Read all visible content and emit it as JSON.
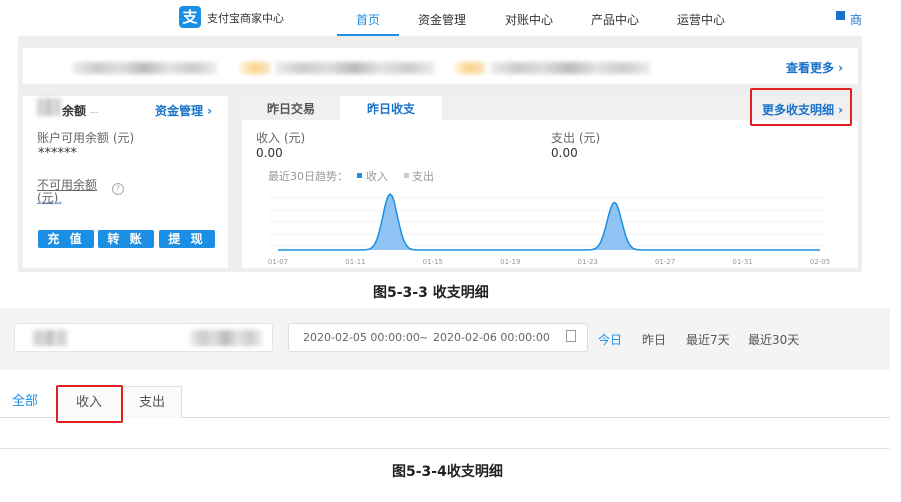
{
  "header": {
    "logo_glyph": "支",
    "brand": "支付宝商家中心",
    "nav": [
      "首页",
      "资金管理",
      "对账中心",
      "产品中心",
      "运营中心"
    ],
    "nav_active": 0,
    "right_label": "商"
  },
  "banner": {
    "more_link": "查看更多 ›"
  },
  "balance": {
    "title_suffix": "余额",
    "manage_link": "资金管理 ›",
    "available_label": "账户可用余额 (元)",
    "available_value": "******",
    "unavailable_label": "不可用余额\n(元)",
    "unavailable_value": "******",
    "buttons": [
      "充 值",
      "转 账",
      "提 现"
    ]
  },
  "summary": {
    "tabs": [
      "昨日交易",
      "昨日收支"
    ],
    "active_tab": 1,
    "more_link": "更多收支明细 ›",
    "income_label": "收入 (元)",
    "income_value": "0.00",
    "expense_label": "支出 (元)",
    "expense_value": "0.00",
    "trend_label": "最近30日趋势：",
    "legend": [
      "收入",
      "支出"
    ]
  },
  "chart_data": {
    "type": "area",
    "title": "最近30日趋势",
    "x_ticks": [
      "01-07",
      "01-11",
      "01-15",
      "01-19",
      "01-23",
      "01-27",
      "01-31",
      "02-05"
    ],
    "series": [
      {
        "name": "收入",
        "color": "#1a8fe3",
        "peaks": [
          {
            "day_index": 6,
            "value": 1
          },
          {
            "day_index": 18,
            "value": 0.85
          }
        ]
      },
      {
        "name": "支出",
        "color": "#cccccc",
        "peaks": []
      }
    ],
    "days": 30,
    "grid": true
  },
  "captions": {
    "first": "图5-3-3 收支明细",
    "second": "图5-3-4收支明细"
  },
  "filter": {
    "date_range_start": "2020-02-05 00:00:00",
    "separator": "~",
    "date_range_end": "2020-02-06 00:00:00",
    "quick": [
      "今日",
      "昨日",
      "最近7天",
      "最近30天"
    ]
  },
  "detail_tabs": [
    "全部",
    "收入",
    "支出"
  ],
  "colors": {
    "accent": "#1a8fe3",
    "highlight": "#e02020"
  }
}
